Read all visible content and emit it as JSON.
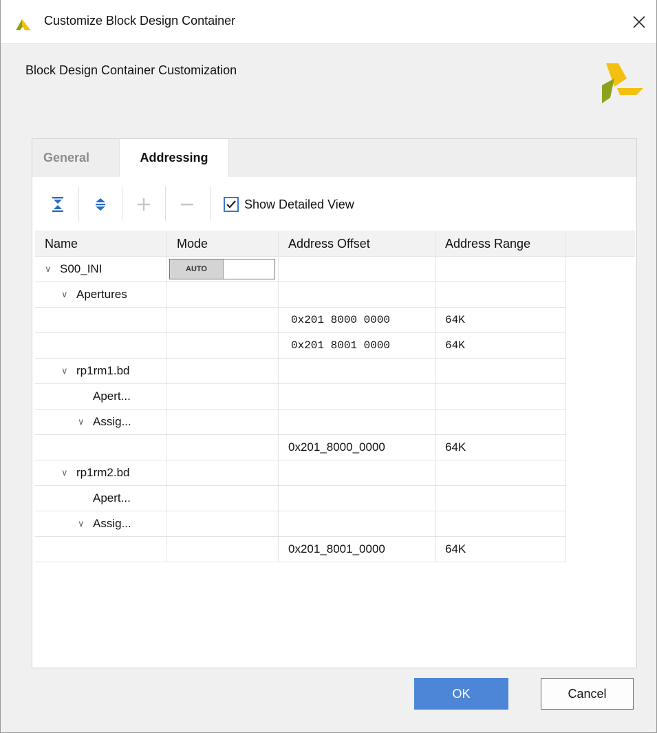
{
  "window": {
    "title": "Customize Block Design Container",
    "logo_icon": "xilinx-logo-icon",
    "close_icon": "close-icon"
  },
  "header": {
    "subtitle": "Block Design Container Customization"
  },
  "tabs": [
    {
      "label": "General",
      "active": false
    },
    {
      "label": "Addressing",
      "active": true
    }
  ],
  "toolbar": {
    "collapse_all_icon": "collapse-all-icon",
    "expand_all_icon": "expand-all-icon",
    "add_icon": "plus-icon",
    "remove_icon": "minus-icon",
    "show_detailed_label": "Show Detailed View",
    "show_detailed_checked": true
  },
  "table": {
    "columns": [
      "Name",
      "Mode",
      "Address Offset",
      "Address Range"
    ],
    "rows": [
      {
        "name": "S00_INI",
        "indent": 0,
        "expander": true,
        "mode": "AUTO",
        "offset": "",
        "range": "",
        "mono": false
      },
      {
        "name": "Apertures",
        "indent": 1,
        "expander": true,
        "mode": "",
        "offset": "",
        "range": "",
        "mono": false
      },
      {
        "name": "",
        "indent": 0,
        "expander": false,
        "mode": "",
        "offset": "0x201 8000 0000",
        "range": "64K",
        "mono": true
      },
      {
        "name": "",
        "indent": 0,
        "expander": false,
        "mode": "",
        "offset": "0x201 8001 0000",
        "range": "64K",
        "mono": true
      },
      {
        "name": "rp1rm1.bd",
        "indent": 1,
        "expander": true,
        "mode": "",
        "offset": "",
        "range": "",
        "mono": false
      },
      {
        "name": "Apert...",
        "indent": 2,
        "expander": false,
        "mode": "",
        "offset": "",
        "range": "",
        "mono": false
      },
      {
        "name": "Assig...",
        "indent": 2,
        "expander": true,
        "mode": "",
        "offset": "",
        "range": "",
        "mono": false
      },
      {
        "name": "",
        "indent": 0,
        "expander": false,
        "mode": "",
        "offset": "0x201_8000_0000",
        "range": "64K",
        "mono": false
      },
      {
        "name": "rp1rm2.bd",
        "indent": 1,
        "expander": true,
        "mode": "",
        "offset": "",
        "range": "",
        "mono": false
      },
      {
        "name": "Apert...",
        "indent": 2,
        "expander": false,
        "mode": "",
        "offset": "",
        "range": "",
        "mono": false
      },
      {
        "name": "Assig...",
        "indent": 2,
        "expander": true,
        "mode": "",
        "offset": "",
        "range": "",
        "mono": false
      },
      {
        "name": "",
        "indent": 0,
        "expander": false,
        "mode": "",
        "offset": "0x201_8001_0000",
        "range": "64K",
        "mono": false
      }
    ]
  },
  "footer": {
    "ok_label": "OK",
    "cancel_label": "Cancel"
  },
  "colors": {
    "accent": "#4d86d6",
    "logo_yellow": "#f3c012",
    "logo_green": "#8aa21c"
  }
}
